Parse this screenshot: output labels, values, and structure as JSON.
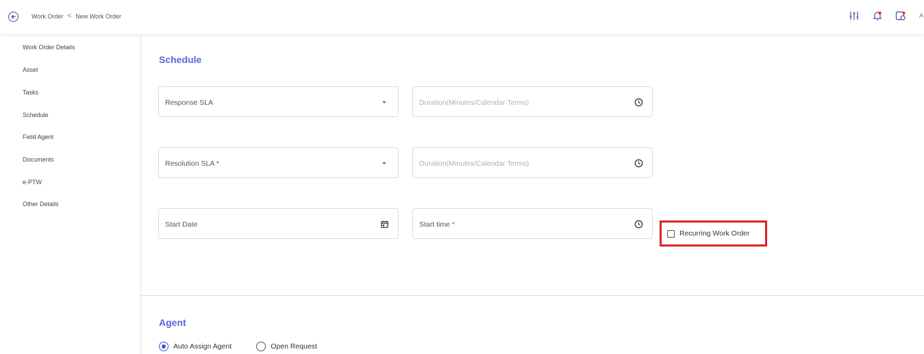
{
  "breadcrumb": {
    "parent": "Work Order",
    "separator": "<",
    "current": "New Work Order"
  },
  "header_icons": [
    "filter-sliders-icon",
    "notification-bell-icon",
    "calendar-sync-icon",
    "user-icon"
  ],
  "sidebar": {
    "items": [
      {
        "label": "Work Order Details"
      },
      {
        "label": "Asset"
      },
      {
        "label": "Tasks"
      },
      {
        "label": "Schedule"
      },
      {
        "label": "Field Agent"
      },
      {
        "label": "Documents"
      },
      {
        "label": "e-PTW"
      },
      {
        "label": "Other Details"
      }
    ]
  },
  "schedule": {
    "title": "Schedule",
    "response_sla": {
      "label": "Response SLA",
      "icon": "chevron-down-icon"
    },
    "response_duration": {
      "placeholder": "Duration(Minutes/Calendar Terms)",
      "icon": "clock-icon"
    },
    "resolution_sla": {
      "label": "Resolution SLA *",
      "icon": "chevron-down-icon"
    },
    "resolution_duration": {
      "placeholder": "Duration(Minutes/Calendar Terms)",
      "icon": "clock-icon"
    },
    "start_date": {
      "label": "Start Date",
      "icon": "calendar-icon"
    },
    "start_time": {
      "label": "Start time",
      "required_mark": "*",
      "icon": "clock-icon"
    },
    "recurring": {
      "label": "Recurring Work Order",
      "checked": false
    }
  },
  "agent": {
    "title": "Agent",
    "options": [
      {
        "label": "Auto Assign Agent",
        "selected": true
      },
      {
        "label": "Open Request",
        "selected": false
      }
    ]
  },
  "colors": {
    "accent": "#5b63d8",
    "highlight_border": "#e01f26",
    "radio_selected": "#3d55d6"
  }
}
